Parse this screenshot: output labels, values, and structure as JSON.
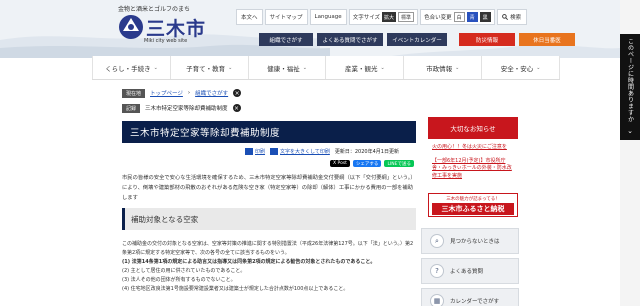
{
  "header": {
    "tagline": "金物と酒米とゴルフのまち",
    "city_name": "三木市",
    "city_sub": "Miki city web site",
    "utility": {
      "home": "本文へ",
      "sitemap": "サイトマップ",
      "language": "Language",
      "text_size_label": "文字サイズ",
      "enlarge": "拡大",
      "standard": "標準",
      "color_label": "色合い変更",
      "color_opt1": "白",
      "color_opt2": "青",
      "color_opt3": "黒",
      "search": "検索"
    },
    "buttons": {
      "org": "組織でさがす",
      "faq": "よくある質問でさがす",
      "calendar": "イベントカレンダー",
      "disaster": "防災情報",
      "holiday_clinic": "休日当番医"
    }
  },
  "gnav": [
    {
      "label": "くらし・手続き"
    },
    {
      "label": "子育て・教育"
    },
    {
      "label": "健康・福祉"
    },
    {
      "label": "産業・観光"
    },
    {
      "label": "市政情報"
    },
    {
      "label": "安全・安心"
    }
  ],
  "breadcrumb": {
    "current_tag": "現在地",
    "links": [
      "トップページ",
      "組織でさがす"
    ],
    "history_tag": "記録",
    "history_item": "三木市特定空家等除却費補助制度"
  },
  "main": {
    "title": "三木市特定空家等除却費補助制度",
    "tools": {
      "print": "印刷",
      "large_print": "文字を大きくして印刷",
      "updated": "更新日：2020年4月1日更新"
    },
    "share": {
      "x": "X Post",
      "fb": "シェアする",
      "line": "LINEで送る"
    },
    "intro": "市民の皆様の安全で安心な生活環境を確保するため、三木市特定空家等除却費補助金交付要綱（以下「交付要綱」という。）により、倒壊や建築部材の飛散のおそれがある危険な空き家（特定空家等）の除却（解体）工事にかかる費用の一部を補助します",
    "section_heading": "補助対象となる空家",
    "body_lead": "この補助金の交付の対象となる空家は、空家等対策の推進に関する特別措置法（平成26年法律第127号。以下「法」という。）第2条第2項に規定する特定空家等で、次の各号の全てに該当するものをいう。",
    "body_items": [
      "(1) 法第14条第1項の規定による助言又は指導又は同条第2項の規定による勧告の対象とされたものであること。",
      "(2) 主として居住の用に供されていたものであること。",
      "(3) 法人その他の団体が所有するものでないこと。",
      "(4) 住宅地区改良法第1号施設要常建設業者又は建築士が規定した合計点数が100点以上であること。"
    ]
  },
  "sidebar": {
    "news_title": "大切なお知らせ",
    "news": [
      "火の用心！！冬は火災にご注意を",
      "【一部6年12月(予定)】市役所庁舎・みっきぃホールの外装・防水改修工事を実施"
    ],
    "banner_top": "三木の魅力が詰まってる！",
    "banner_main": "三木市ふるさと納税",
    "quick": [
      {
        "label": "見つからないときは",
        "icon": "search-icon"
      },
      {
        "label": "よくある質問",
        "icon": "question-icon"
      },
      {
        "label": "カレンダーでさがす",
        "icon": "calendar-icon"
      }
    ]
  },
  "side_tab": {
    "label": "このページに時間ありますか",
    "icon": "chevron-down-icon"
  }
}
